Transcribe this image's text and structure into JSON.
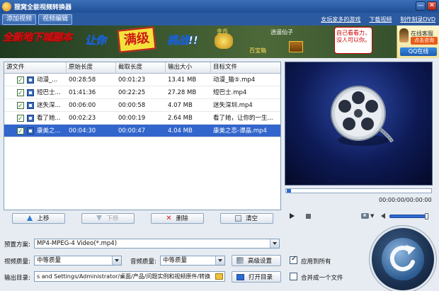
{
  "window": {
    "title": "狸窝全能视频转换器",
    "min_glyph": "—",
    "close_glyph": "✕"
  },
  "menubar": {
    "tabs": [
      "添加视频",
      "视频编辑"
    ],
    "links": [
      "女玩家多的游戏",
      "下载视频",
      "制作刻录DVD"
    ]
  },
  "banner": {
    "headline": "全新地下城副本",
    "rang": "让你",
    "manji": "满级",
    "tiaozhan": "挑战!!",
    "gold": "金币",
    "baoxiang": "百宝箱",
    "xianzi": "逍遥仙子",
    "bubble": "自己看看力，没人可以你。"
  },
  "qq": {
    "online": "在线客服",
    "click": "点击咨询",
    "button": "QQ在线"
  },
  "table": {
    "headers": [
      "源文件",
      "原始长度",
      "截取长度",
      "输出大小",
      "目标文件"
    ],
    "rows": [
      {
        "name": "动漫_...",
        "orig": "00:28:58",
        "cut": "00:01:23",
        "size": "13.41 MB",
        "target": "动漫_猫⑤.mp4",
        "selected": false
      },
      {
        "name": "短巴士...",
        "orig": "01:41:36",
        "cut": "00:22:25",
        "size": "27.28 MB",
        "target": "短巴士.mp4",
        "selected": false
      },
      {
        "name": "迷失深...",
        "orig": "00:06:00",
        "cut": "00:00:58",
        "size": "4.07 MB",
        "target": "迷失深圳.mp4",
        "selected": false
      },
      {
        "name": "看了她...",
        "orig": "00:02:23",
        "cut": "00:00:19",
        "size": "2.64 MB",
        "target": "看了她，让你的一生...",
        "selected": false
      },
      {
        "name": "康美之...",
        "orig": "00:04:30",
        "cut": "00:00:47",
        "size": "4.04 MB",
        "target": "康美之恋-谭晶.mp4",
        "selected": true
      }
    ]
  },
  "list_toolbar": {
    "up": "上移",
    "down": "下移",
    "delete": "删除",
    "clear": "清空"
  },
  "player": {
    "timecode": "00:00:00/00:00:00",
    "seek_position": 0,
    "volume_level": 0.95
  },
  "settings": {
    "preset_label": "预置方案:",
    "preset_value": "MP4-MPEG-4 Video(*.mp4)",
    "video_quality_label": "视频质量:",
    "video_quality_value": "中等质量",
    "audio_quality_label": "音频质量:",
    "audio_quality_value": "中等质量",
    "advanced_button": "高级设置",
    "apply_all_label": "应用到所有",
    "apply_all_checked": true,
    "output_label": "输出目录:",
    "output_path": "s and Settings/Administrator/桌面/产品/问题实例和视频原件/转换",
    "open_dir_button": "打开目录",
    "merge_label": "合并成一个文件",
    "merge_checked": false
  },
  "colors": {
    "titlebar": "#2c5aa0",
    "selection": "#3366cc",
    "accent": "#2e6ad0"
  }
}
